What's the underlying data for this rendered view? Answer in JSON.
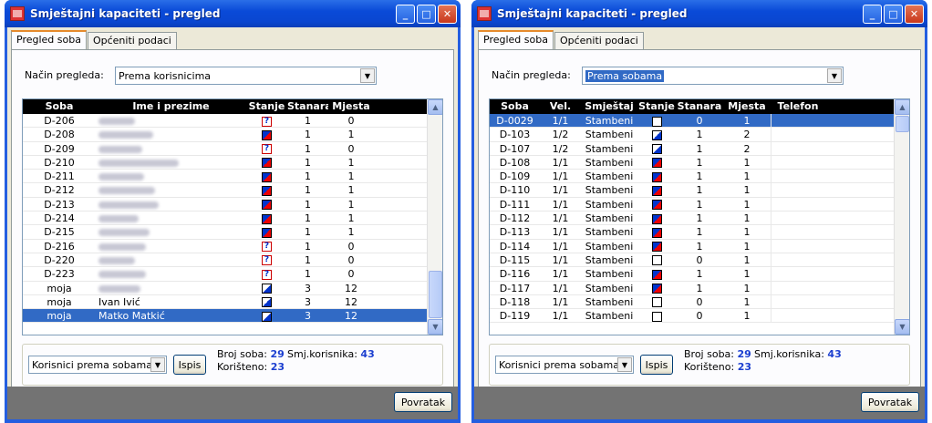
{
  "left": {
    "title": "Smještajni kapaciteti - pregled",
    "tabs": [
      "Pregled soba",
      "Općeniti podaci"
    ],
    "mode_label": "Način pregleda:",
    "mode_value": "Prema korisnicima",
    "columns": [
      "Soba",
      "Ime i prezime",
      "Stanje",
      "Stanara",
      "Mjesta"
    ],
    "rows": [
      {
        "soba": "D-206",
        "ime": "",
        "stanje": "q",
        "stanara": "1",
        "mjesta": "0"
      },
      {
        "soba": "D-208",
        "ime": "",
        "stanje": "full",
        "stanara": "1",
        "mjesta": "1"
      },
      {
        "soba": "D-209",
        "ime": "",
        "stanje": "q",
        "stanara": "1",
        "mjesta": "0"
      },
      {
        "soba": "D-210",
        "ime": "",
        "stanje": "full",
        "stanara": "1",
        "mjesta": "1"
      },
      {
        "soba": "D-211",
        "ime": "",
        "stanje": "full",
        "stanara": "1",
        "mjesta": "1"
      },
      {
        "soba": "D-212",
        "ime": "",
        "stanje": "full",
        "stanara": "1",
        "mjesta": "1"
      },
      {
        "soba": "D-213",
        "ime": "",
        "stanje": "full",
        "stanara": "1",
        "mjesta": "1"
      },
      {
        "soba": "D-214",
        "ime": "",
        "stanje": "full",
        "stanara": "1",
        "mjesta": "1"
      },
      {
        "soba": "D-215",
        "ime": "",
        "stanje": "full",
        "stanara": "1",
        "mjesta": "1"
      },
      {
        "soba": "D-216",
        "ime": "",
        "stanje": "q",
        "stanara": "1",
        "mjesta": "0"
      },
      {
        "soba": "D-220",
        "ime": "",
        "stanje": "q",
        "stanara": "1",
        "mjesta": "0"
      },
      {
        "soba": "D-223",
        "ime": "",
        "stanje": "q",
        "stanara": "1",
        "mjesta": "0"
      },
      {
        "soba": "moja",
        "ime": "",
        "stanje": "part",
        "stanara": "3",
        "mjesta": "12"
      },
      {
        "soba": "moja",
        "ime": "Ivan Ivić",
        "stanje": "part",
        "stanara": "3",
        "mjesta": "12"
      },
      {
        "soba": "moja",
        "ime": "Matko Matkić",
        "stanje": "part",
        "stanara": "3",
        "mjesta": "12",
        "selected": true
      }
    ],
    "bottom_combo": "Korisnici prema sobama",
    "ispis": "Ispis",
    "broj_soba_label": "Broj soba:",
    "broj_soba": "29",
    "koristeno_label": "Korišteno:",
    "koristeno": "23",
    "smj_label": "Smj.korisnika:",
    "smj": "43",
    "povratak": "Povratak"
  },
  "right": {
    "title": "Smještajni kapaciteti - pregled",
    "tabs": [
      "Pregled soba",
      "Općeniti podaci"
    ],
    "mode_label": "Način pregleda:",
    "mode_value": "Prema sobama",
    "columns": [
      "Soba",
      "Vel.",
      "Smještaj",
      "Stanje",
      "Stanara",
      "Mjesta",
      "Telefon"
    ],
    "rows": [
      {
        "soba": "D-0029",
        "vel": "1/1",
        "smjestaj": "Stambeni",
        "stanje": "empty",
        "stanara": "0",
        "mjesta": "1",
        "selected": true
      },
      {
        "soba": "D-103",
        "vel": "1/2",
        "smjestaj": "Stambeni",
        "stanje": "part",
        "stanara": "1",
        "mjesta": "2"
      },
      {
        "soba": "D-107",
        "vel": "1/2",
        "smjestaj": "Stambeni",
        "stanje": "part",
        "stanara": "1",
        "mjesta": "2"
      },
      {
        "soba": "D-108",
        "vel": "1/1",
        "smjestaj": "Stambeni",
        "stanje": "full",
        "stanara": "1",
        "mjesta": "1"
      },
      {
        "soba": "D-109",
        "vel": "1/1",
        "smjestaj": "Stambeni",
        "stanje": "full",
        "stanara": "1",
        "mjesta": "1"
      },
      {
        "soba": "D-110",
        "vel": "1/1",
        "smjestaj": "Stambeni",
        "stanje": "full",
        "stanara": "1",
        "mjesta": "1"
      },
      {
        "soba": "D-111",
        "vel": "1/1",
        "smjestaj": "Stambeni",
        "stanje": "full",
        "stanara": "1",
        "mjesta": "1"
      },
      {
        "soba": "D-112",
        "vel": "1/1",
        "smjestaj": "Stambeni",
        "stanje": "full",
        "stanara": "1",
        "mjesta": "1"
      },
      {
        "soba": "D-113",
        "vel": "1/1",
        "smjestaj": "Stambeni",
        "stanje": "full",
        "stanara": "1",
        "mjesta": "1"
      },
      {
        "soba": "D-114",
        "vel": "1/1",
        "smjestaj": "Stambeni",
        "stanje": "full",
        "stanara": "1",
        "mjesta": "1"
      },
      {
        "soba": "D-115",
        "vel": "1/1",
        "smjestaj": "Stambeni",
        "stanje": "empty",
        "stanara": "0",
        "mjesta": "1"
      },
      {
        "soba": "D-116",
        "vel": "1/1",
        "smjestaj": "Stambeni",
        "stanje": "full",
        "stanara": "1",
        "mjesta": "1"
      },
      {
        "soba": "D-117",
        "vel": "1/1",
        "smjestaj": "Stambeni",
        "stanje": "full",
        "stanara": "1",
        "mjesta": "1"
      },
      {
        "soba": "D-118",
        "vel": "1/1",
        "smjestaj": "Stambeni",
        "stanje": "empty",
        "stanara": "0",
        "mjesta": "1"
      },
      {
        "soba": "D-119",
        "vel": "1/1",
        "smjestaj": "Stambeni",
        "stanje": "empty",
        "stanara": "0",
        "mjesta": "1"
      }
    ],
    "bottom_combo": "Korisnici prema sobama",
    "ispis": "Ispis",
    "broj_soba_label": "Broj soba:",
    "broj_soba": "29",
    "koristeno_label": "Korišteno:",
    "koristeno": "23",
    "smj_label": "Smj.korisnika:",
    "smj": "43",
    "povratak": "Povratak"
  },
  "colors": {
    "titlebar": "#0a46d0",
    "selection": "#316ac5",
    "stat_number": "#1c3fd0",
    "footer": "#737373"
  }
}
